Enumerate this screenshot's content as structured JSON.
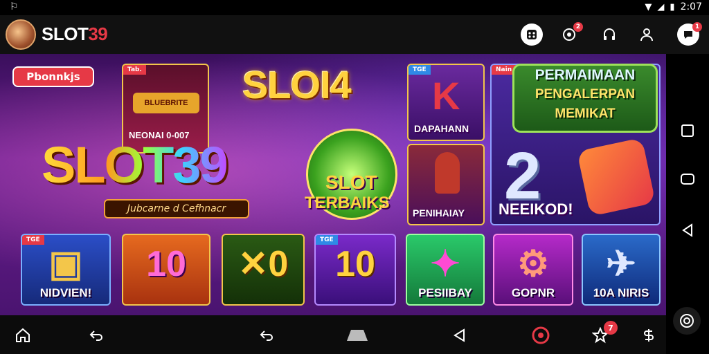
{
  "status_bar": {
    "time": "2:07",
    "left_icon": "alert-icon",
    "right_icons": [
      "wifi-icon",
      "signal-icon",
      "battery-icon"
    ]
  },
  "header": {
    "brand_prefix": "SLOT",
    "brand_number": "39",
    "icons": [
      {
        "name": "games-icon",
        "badge": ""
      },
      {
        "name": "bonus-icon",
        "badge": "2"
      },
      {
        "name": "support-icon",
        "badge": ""
      },
      {
        "name": "profile-icon",
        "badge": ""
      },
      {
        "name": "chat-icon",
        "badge": "1"
      }
    ]
  },
  "banner": {
    "tag": "Pbonnkjs",
    "hero_text": "SLOT39",
    "hero_subtitle": "Jubcarne d Cefhnacr",
    "top_title": "SLOI4",
    "card_top_left_ribbon": "Tab.",
    "card_top_left_sign": "BLUEBRITE",
    "card_top_left_caption": "NEONAI 0-007",
    "center_cat_line1": "SLOT",
    "center_cat_line2": "TERBAIKS",
    "card_dapahann": "DAPAHANN",
    "card_dapahann_tag": "TGE",
    "card_peninay": "PENIHAIAY",
    "green_banner": [
      "PERMAIMAAN",
      "PENGALERPAN",
      "MEMIKAT"
    ],
    "green_ribbon": "Nain",
    "big_number": "2",
    "neeikod": "NEEIKOD!",
    "tiles": [
      {
        "label": "NIDVIEN!",
        "art": "▣",
        "ribbon": "TGE"
      },
      {
        "label": "",
        "art": "10",
        "ribbon": ""
      },
      {
        "label": "",
        "art": "✕0",
        "ribbon": ""
      },
      {
        "label": "",
        "art": "10",
        "ribbon": "TGE"
      },
      {
        "label": "PESIIBAY",
        "art": "✦",
        "ribbon": ""
      },
      {
        "label": "GOPNR",
        "art": "⚙",
        "ribbon": ""
      },
      {
        "label": "10A NIRIS",
        "art": "✈",
        "ribbon": ""
      }
    ]
  },
  "bottom_nav": [
    {
      "name": "home-icon"
    },
    {
      "name": "back-icon"
    },
    {
      "name": "undo-icon"
    },
    {
      "name": "keyboard-icon"
    },
    {
      "name": "triangle-back-icon"
    },
    {
      "name": "app-logo-icon"
    },
    {
      "name": "rewards-icon",
      "badge": "7"
    },
    {
      "name": "currency-icon"
    }
  ],
  "system_nav": [
    "recents-icon",
    "screenshot-icon",
    "back-triangle-icon",
    "assistant-icon"
  ]
}
